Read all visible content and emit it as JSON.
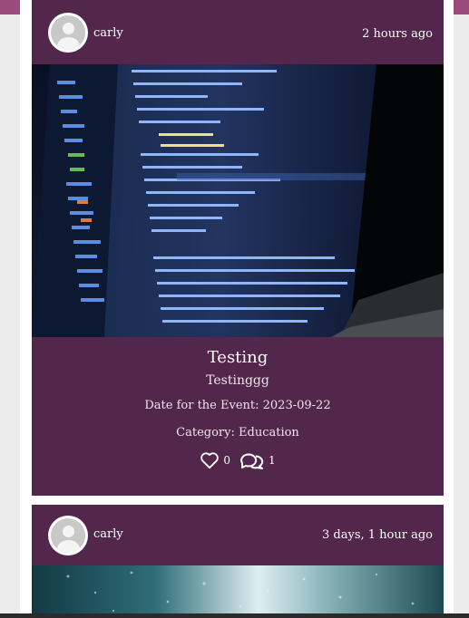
{
  "posts": [
    {
      "author": "carly",
      "timestamp": "2 hours ago",
      "title": "Testing",
      "description": "Testinggg",
      "event_date": "Date for the Event: 2023-09-22",
      "category": "Category: Education",
      "likes": "0",
      "comments": "1",
      "image_icon": "code-editor-photo"
    },
    {
      "author": "carly",
      "timestamp": "3 days, 1 hour ago",
      "image_icon": "rainy-window-photo"
    }
  ],
  "colors": {
    "card_background": "#52274b",
    "navbar": "#9b4a7c",
    "page_background": "#ececec"
  }
}
